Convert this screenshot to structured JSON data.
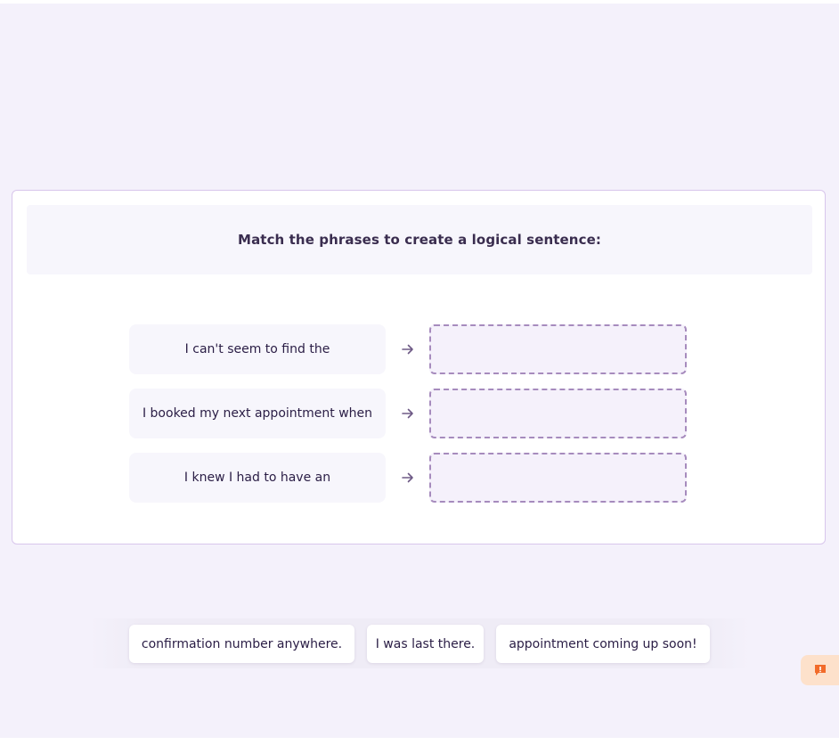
{
  "instruction": "Match the phrases to create a logical sentence:",
  "rows": [
    {
      "prompt": "I can't seem to find the"
    },
    {
      "prompt": "I booked my next appointment when"
    },
    {
      "prompt": "I knew I had to have an"
    }
  ],
  "options": [
    {
      "label": "confirmation number anywhere."
    },
    {
      "label": "I was last there."
    },
    {
      "label": "appointment coming up soon!"
    }
  ],
  "icons": {
    "arrow": "arrow-right-icon",
    "feedback": "feedback-alert-icon"
  },
  "colors": {
    "background": "#f4f1fb",
    "card_border": "#d8c6ec",
    "dropzone_border": "#a68bbd",
    "text": "#2a1d45",
    "feedback_bg": "#fde1cb",
    "feedback_icon": "#f26b2a"
  }
}
